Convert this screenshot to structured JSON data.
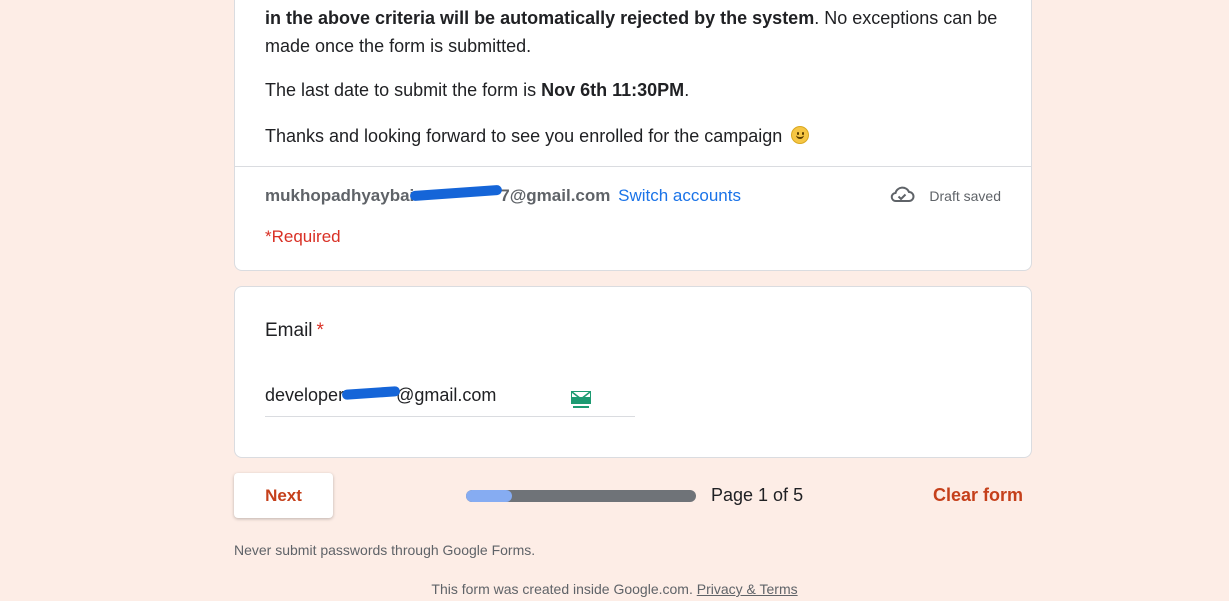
{
  "description": {
    "p1_bold": "in the above criteria  will be automatically rejected by the system",
    "p1_rest": ". No exceptions can be made once the form is submitted.",
    "p2_prefix": "The last date to submit the form is ",
    "p2_bold": "Nov 6th 11:30PM",
    "p2_suffix": ".",
    "p3_text": "Thanks and looking forward to see you enrolled for the campaign "
  },
  "account": {
    "email_prefix": "mukhopadhyaybai",
    "email_suffix": "7@gmail.com",
    "switch_label": "Switch accounts",
    "draft_status": "Draft saved",
    "draft_icon": "cloud-check-icon"
  },
  "required_note": "*Required",
  "email_question": {
    "label": "Email",
    "required_marker": "*",
    "value_prefix": "developer",
    "value_suffix": "@gmail.com",
    "badge_icon": "mail-extension-icon"
  },
  "navigation": {
    "next_label": "Next",
    "progress_fraction": 0.2,
    "page_indicator": "Page 1 of 5",
    "clear_label": "Clear form"
  },
  "footer": {
    "password_warning": "Never submit passwords through Google Forms.",
    "created_text": "This form was created inside Google.com. ",
    "privacy_link": "Privacy & Terms"
  },
  "colors": {
    "background": "#fdede6",
    "accent": "#c5401b",
    "link": "#1a73e8",
    "required": "#d93025",
    "progress_fill": "#86acf2",
    "progress_track": "#6f7378"
  }
}
